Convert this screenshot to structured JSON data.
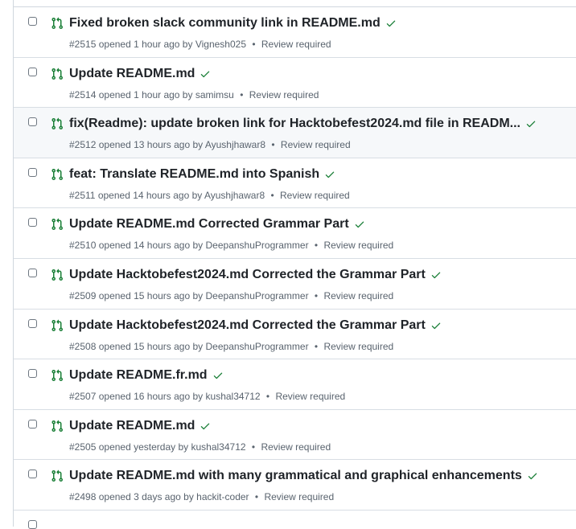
{
  "colors": {
    "open_icon": "#1a7f37",
    "check": "#1a7f37",
    "title": "#1f2328",
    "meta": "#59636e",
    "hover_row": "#f6f8fa",
    "border": "#d0d7de"
  },
  "icons": {
    "status": "git-pull-request-open-icon",
    "ci": "check-icon"
  },
  "pull_requests": [
    {
      "title": "Fixed broken slack community link in README.md",
      "number": "#2515",
      "opened": "opened 1 hour ago by",
      "author": "Vignesh025",
      "separator": "•",
      "review": "Review required"
    },
    {
      "title": "Update README.md",
      "number": "#2514",
      "opened": "opened 1 hour ago by",
      "author": "samimsu",
      "separator": "•",
      "review": "Review required"
    },
    {
      "title": "fix(Readme): update broken link for Hacktobefest2024.md file in READM...",
      "number": "#2512",
      "opened": "opened 13 hours ago by",
      "author": "Ayushjhawar8",
      "separator": "•",
      "review": "Review required"
    },
    {
      "title": "feat: Translate README.md into Spanish",
      "number": "#2511",
      "opened": "opened 14 hours ago by",
      "author": "Ayushjhawar8",
      "separator": "•",
      "review": "Review required"
    },
    {
      "title": "Update README.md Corrected Grammar Part",
      "number": "#2510",
      "opened": "opened 14 hours ago by",
      "author": "DeepanshuProgrammer",
      "separator": "•",
      "review": "Review required"
    },
    {
      "title": "Update Hacktobefest2024.md Corrected the Grammar Part",
      "number": "#2509",
      "opened": "opened 15 hours ago by",
      "author": "DeepanshuProgrammer",
      "separator": "•",
      "review": "Review required"
    },
    {
      "title": "Update Hacktobefest2024.md Corrected the Grammar Part",
      "number": "#2508",
      "opened": "opened 15 hours ago by",
      "author": "DeepanshuProgrammer",
      "separator": "•",
      "review": "Review required"
    },
    {
      "title": "Update README.fr.md",
      "number": "#2507",
      "opened": "opened 16 hours ago by",
      "author": "kushal34712",
      "separator": "•",
      "review": "Review required"
    },
    {
      "title": "Update README.md",
      "number": "#2505",
      "opened": "opened yesterday by",
      "author": "kushal34712",
      "separator": "•",
      "review": "Review required"
    },
    {
      "title": "Update README.md with many grammatical and graphical enhancements",
      "number": "#2498",
      "opened": "opened 3 days ago by",
      "author": "hackit-coder",
      "separator": "•",
      "review": "Review required"
    }
  ]
}
